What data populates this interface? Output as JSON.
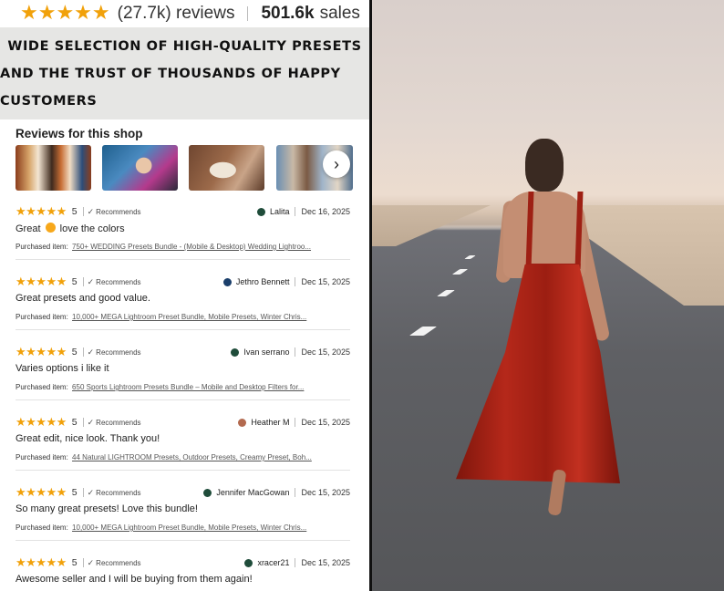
{
  "header": {
    "stars": "★★★★★",
    "review_count": "(27.7k) reviews",
    "sales_number": "501.6k",
    "sales_word": "sales"
  },
  "banner": {
    "line1": "WIDE SELECTION OF HIGH-QUALITY PRESETS",
    "line2": "AND THE TRUST OF THOUSANDS OF HAPPY CUSTOMERS"
  },
  "reviews_section": {
    "title": "Reviews for this shop",
    "next_arrow": "›"
  },
  "reviews": [
    {
      "stars": "★★★★★",
      "rating": "5",
      "recommends": "Recommends",
      "user": "Lalita",
      "avatar_color": "#1f4c3a",
      "date": "Dec 16, 2025",
      "text_before": "Great",
      "text_after": "love the colors",
      "purchased_label": "Purchased item:",
      "purchased_item": "750+ WEDDING Presets Bundle - (Mobile & Desktop) Wedding Lightroo..."
    },
    {
      "stars": "★★★★★",
      "rating": "5",
      "recommends": "Recommends",
      "user": "Jethro Bennett",
      "avatar_color": "#1b3f6b",
      "date": "Dec 15, 2025",
      "text": "Great presets and good value.",
      "purchased_label": "Purchased item:",
      "purchased_item": "10,000+ MEGA Lightroom Preset Bundle, Mobile Presets, Winter Chris..."
    },
    {
      "stars": "★★★★★",
      "rating": "5",
      "recommends": "Recommends",
      "user": "Ivan serrano",
      "avatar_color": "#1f4c3a",
      "date": "Dec 15, 2025",
      "text": "Varies options i like it",
      "purchased_label": "Purchased item:",
      "purchased_item": "650 Sports Lightroom Presets Bundle – Mobile and Desktop Filters for..."
    },
    {
      "stars": "★★★★★",
      "rating": "5",
      "recommends": "Recommends",
      "user": "Heather M",
      "avatar_color": "#b36a4f",
      "date": "Dec 15, 2025",
      "text": "Great edit, nice look. Thank you!",
      "purchased_label": "Purchased item:",
      "purchased_item": "44 Natural LIGHTROOM Presets, Outdoor Presets, Creamy Preset, Boh..."
    },
    {
      "stars": "★★★★★",
      "rating": "5",
      "recommends": "Recommends",
      "user": "Jennifer MacGowan",
      "avatar_color": "#1f4c3a",
      "date": "Dec 15, 2025",
      "text": "So many great presets! Love this bundle!",
      "purchased_label": "Purchased item:",
      "purchased_item": "10,000+ MEGA Lightroom Preset Bundle, Mobile Presets, Winter Chris..."
    },
    {
      "stars": "★★★★★",
      "rating": "5",
      "recommends": "Recommends",
      "user": "xracer21",
      "avatar_color": "#1f4c3a",
      "date": "Dec 15, 2025",
      "text": "Awesome seller and I will be buying from them again!",
      "purchased_label": "",
      "purchased_item": ""
    }
  ],
  "colors": {
    "star": "#f1a10a",
    "banner_bg": "#e6e6e4",
    "dress": "#b5281a"
  }
}
